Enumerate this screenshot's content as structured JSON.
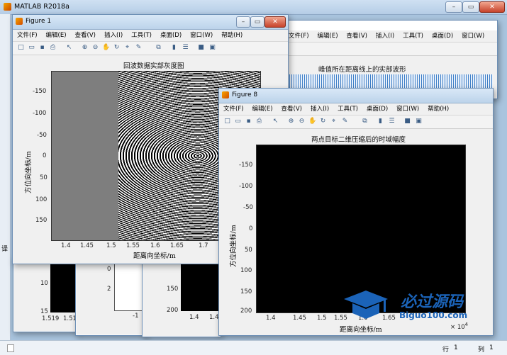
{
  "app": {
    "title": "MATLAB R2018a"
  },
  "menu_items": [
    "文件(F)",
    "编辑(E)",
    "查看(V)",
    "插入(I)",
    "工具(T)",
    "桌面(D)",
    "窗口(W)",
    "帮助(H)"
  ],
  "fig1": {
    "title": "Figure 1",
    "plot_title": "回波数据实部灰度图",
    "ylabel": "方位向坐标/m",
    "xlabel": "距离向坐标/m",
    "yticks": [
      "-150",
      "-100",
      "-50",
      "0",
      "50",
      "100",
      "150"
    ],
    "xticks": [
      "1.4",
      "1.45",
      "1.5",
      "1.55",
      "1.6",
      "1.65",
      "1.7"
    ]
  },
  "fig_mid": {
    "plot_title": "峰值所在距离线上的实部波形"
  },
  "fig8": {
    "title": "Figure 8",
    "plot_title": "两点目标二维压缩后的时域幅度",
    "ylabel": "方位向坐标/m",
    "xlabel": "距离向坐标/m",
    "yticks": [
      "-150",
      "-100",
      "-50",
      "0",
      "50",
      "100",
      "150",
      "200"
    ],
    "xticks": [
      "1.4",
      "1.45",
      "1.5",
      "1.55",
      "1.6",
      "1.65"
    ],
    "x_exponent": "× 10",
    "x_exponent_power": "4"
  },
  "background_figs": {
    "a": {
      "yticks": [
        "10",
        "15"
      ],
      "xticks": [
        "1.519",
        "1.519"
      ]
    },
    "b": {
      "yticks": [
        "2",
        "0"
      ],
      "xtick": "-1"
    },
    "c": {
      "yticks": [
        "150",
        "200"
      ],
      "xticks": [
        "1.4",
        "1.45"
      ]
    }
  },
  "side_label": "译",
  "statusbar": {
    "row_label": "行",
    "row": "1",
    "col_label": "列",
    "col": "1"
  },
  "watermark": {
    "title": "必过源码",
    "url": "Biguo100.com"
  },
  "chart_data": [
    {
      "type": "heatmap",
      "title": "回波数据实部灰度图",
      "xlabel": "距离向坐标/m",
      "ylabel": "方位向坐标/m",
      "xlim": [
        1.37,
        1.74
      ],
      "ylim": [
        -180,
        190
      ],
      "colormap": "gray"
    },
    {
      "type": "heatmap",
      "title": "两点目标二维压缩后的时域幅度",
      "xlabel": "距离向坐标/m",
      "ylabel": "方位向坐标/m",
      "xlim": [
        1.37,
        1.69
      ],
      "ylim": [
        -190,
        200
      ],
      "colormap": "gray"
    }
  ]
}
